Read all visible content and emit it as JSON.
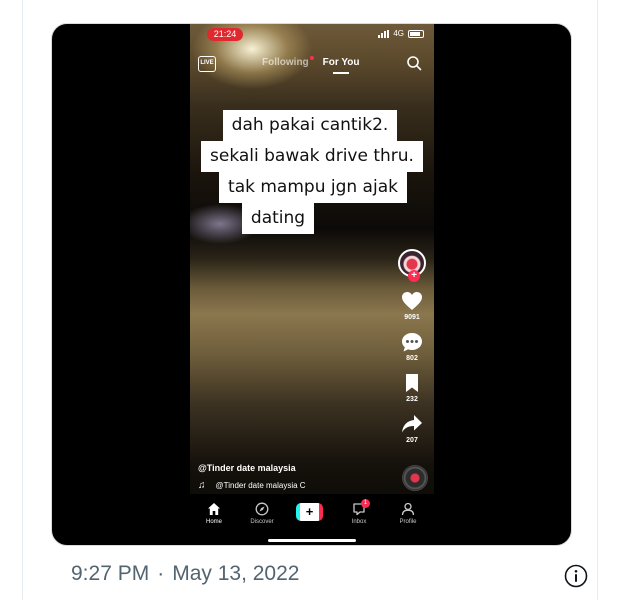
{
  "status_bar": {
    "time": "21:24",
    "network": "4G"
  },
  "tiktok": {
    "live_label": "LIVE",
    "tabs": {
      "following": "Following",
      "for_you": "For You"
    },
    "caption_lines": [
      "dah pakai cantik2.",
      "sekali bawak drive thru.",
      "tak mampu jgn ajak",
      "dating"
    ],
    "counts": {
      "likes": "9091",
      "comments": "802",
      "bookmarks": "232",
      "shares": "207"
    },
    "author": "@Tinder date malaysia",
    "sound": "@Tinder date malaysia C",
    "nav": {
      "home": "Home",
      "discover": "Discover",
      "create": "+",
      "inbox": "Inbox",
      "inbox_badge": "1",
      "profile": "Profile"
    },
    "colors": {
      "accent": "#fe2c55",
      "cyan": "#25f4ee",
      "status_pill": "#e0292f"
    }
  },
  "tweet": {
    "time": "9:27 PM",
    "separator": "·",
    "date": "May 13, 2022"
  }
}
